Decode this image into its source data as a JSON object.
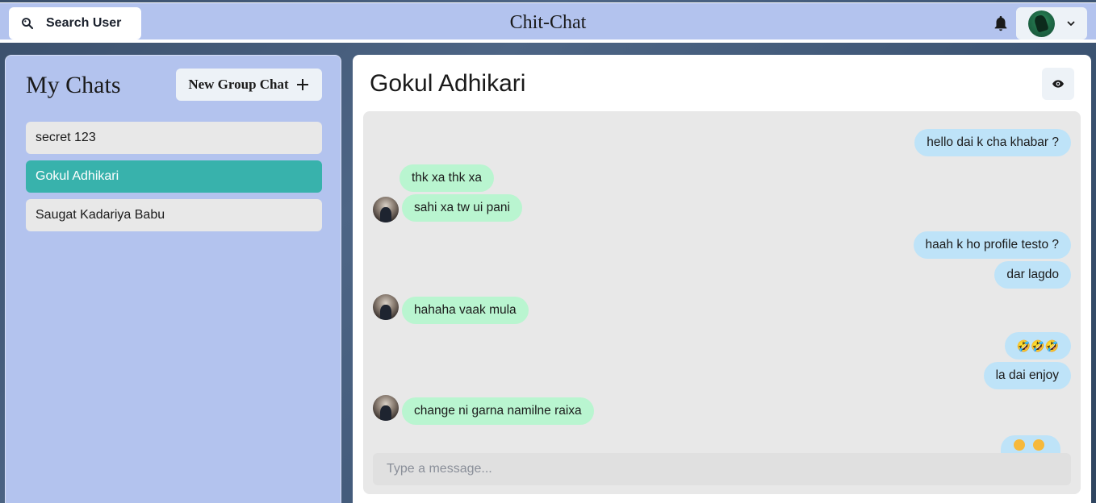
{
  "header": {
    "search_label": "Search User",
    "brand": "Chit-Chat",
    "icons": {
      "search": "search-icon",
      "bell": "bell-icon",
      "chevron": "chevron-down-icon"
    }
  },
  "sidebar": {
    "title": "My Chats",
    "new_group_label": "New Group Chat",
    "chats": [
      {
        "name": "secret 123",
        "active": false
      },
      {
        "name": "Gokul Adhikari",
        "active": true
      },
      {
        "name": "Saugat Kadariya Babu",
        "active": false
      }
    ]
  },
  "chat": {
    "title": "Gokul Adhikari",
    "messages": [
      {
        "text": "hello dai k cha khabar ?",
        "direction": "outgoing"
      },
      {
        "text": "thk xa thk xa",
        "direction": "incoming"
      },
      {
        "text": "sahi xa tw ui pani",
        "direction": "incoming",
        "avatar": true
      },
      {
        "text": "haah k ho profile testo ?",
        "direction": "outgoing"
      },
      {
        "text": "dar lagdo",
        "direction": "outgoing"
      },
      {
        "text": "hahaha vaak mula",
        "direction": "incoming",
        "avatar": true
      },
      {
        "text": "🤣🤣🤣",
        "direction": "outgoing"
      },
      {
        "text": "la dai enjoy",
        "direction": "outgoing"
      },
      {
        "text": "change ni garna namilne raixa",
        "direction": "incoming",
        "avatar": true
      }
    ],
    "input_placeholder": "Type a message..."
  },
  "colors": {
    "header_bg": "#b3c3ee",
    "active_chat": "#38b2ac",
    "outgoing_bubble": "#bee3f8",
    "incoming_bubble": "#b9f5d0"
  }
}
